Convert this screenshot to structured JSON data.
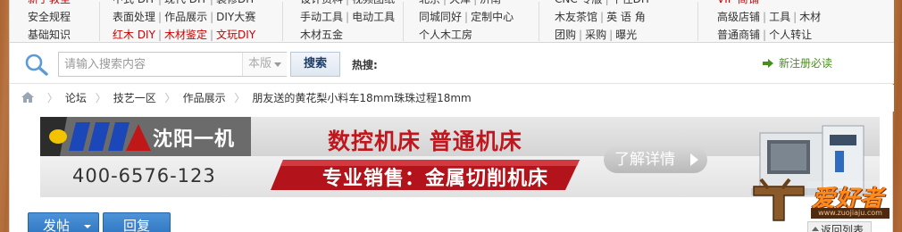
{
  "topnav": {
    "rows": [
      [
        {
          "items": [
            {
              "text": "新手教室",
              "red": true
            }
          ]
        },
        {
          "items": [
            {
              "text": "中式 DIY"
            },
            {
              "text": "现代 DIY"
            },
            {
              "text": "装修DIY"
            }
          ]
        },
        {
          "items": [
            {
              "text": "设计资料"
            },
            {
              "text": "视频图纸"
            }
          ]
        },
        {
          "items": [
            {
              "text": "北京"
            },
            {
              "text": "天津"
            },
            {
              "text": "济南"
            }
          ]
        },
        {
          "items": [
            {
              "text": "CNC 专版"
            },
            {
              "text": "千住DIY"
            }
          ]
        },
        {
          "items": [
            {
              "text": "VIP 商铺",
              "red": true
            }
          ]
        }
      ],
      [
        {
          "items": [
            {
              "text": "安全规程"
            }
          ]
        },
        {
          "items": [
            {
              "text": "表面处理"
            },
            {
              "text": "作品展示"
            },
            {
              "text": "DIY大赛"
            }
          ]
        },
        {
          "items": [
            {
              "text": "手动工具"
            },
            {
              "text": "电动工具"
            }
          ]
        },
        {
          "items": [
            {
              "text": "同城同好"
            },
            {
              "text": "定制中心"
            }
          ]
        },
        {
          "items": [
            {
              "text": "木友茶馆"
            },
            {
              "text": "英 语 角"
            }
          ]
        },
        {
          "items": [
            {
              "text": "高级店铺"
            },
            {
              "text": "工具"
            },
            {
              "text": "木材"
            }
          ]
        }
      ],
      [
        {
          "items": [
            {
              "text": "基础知识"
            }
          ]
        },
        {
          "items": [
            {
              "text": "红木 DIY",
              "red": true
            },
            {
              "text": "木材鉴定",
              "red": true
            },
            {
              "text": "文玩DIY",
              "red": true
            }
          ]
        },
        {
          "items": [
            {
              "text": "木材五金"
            }
          ]
        },
        {
          "items": [
            {
              "text": "个人木工房"
            }
          ]
        },
        {
          "items": [
            {
              "text": "团购"
            },
            {
              "text": "采购"
            },
            {
              "text": "曝光"
            }
          ]
        },
        {
          "items": [
            {
              "text": "普通商铺"
            },
            {
              "text": "个人转让"
            }
          ]
        }
      ]
    ]
  },
  "search": {
    "placeholder": "请输入搜索内容",
    "scope": "本版",
    "button": "搜索",
    "hot_label": "热搜:"
  },
  "register": {
    "label": "新注册必读",
    "icon": "arrow-right-icon",
    "color": "#4a8f1c"
  },
  "breadcrumb": {
    "home_icon": "home-icon",
    "items": [
      "论坛",
      "技艺一区",
      "作品展示",
      "朋友送的黄花梨小料车18mm珠珠过程18mm"
    ]
  },
  "banner": {
    "brand": "沈阳一机",
    "phone": "400-6576-123",
    "headline": "数控机床 普通机床",
    "subline": "专业销售：金属切削机床",
    "detail_button": "了解详情",
    "accent": "#c0171e"
  },
  "site_logo": {
    "text": "爱好者",
    "url": "www.zuojiaju.com"
  },
  "actions": {
    "post": "发帖",
    "reply": "回复",
    "back": "返回列表"
  }
}
